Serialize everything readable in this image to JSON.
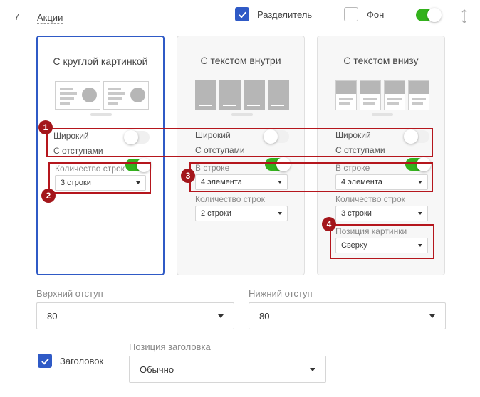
{
  "header": {
    "number": "7",
    "section_title": "Акции",
    "divider_label": "Разделитель",
    "background_label": "Фон"
  },
  "cards": [
    {
      "title": "С круглой картинкой",
      "wide_label": "Широкий",
      "padding_label": "С отступами",
      "rows_label": "Количество строк",
      "rows_value": "3 строки"
    },
    {
      "title": "С текстом внутри",
      "wide_label": "Широкий",
      "padding_label": "С отступами",
      "in_row_label": "В строке",
      "in_row_value": "4 элемента",
      "rows_label": "Количество строк",
      "rows_value": "2 строки"
    },
    {
      "title": "С текстом внизу",
      "wide_label": "Широкий",
      "padding_label": "С отступами",
      "in_row_label": "В строке",
      "in_row_value": "4 элемента",
      "rows_label": "Количество строк",
      "rows_value": "3 строки",
      "image_pos_label": "Позиция картинки",
      "image_pos_value": "Сверху"
    }
  ],
  "badges": [
    "1",
    "2",
    "3",
    "4"
  ],
  "bottom": {
    "top_padding_label": "Верхний отступ",
    "top_padding_value": "80",
    "bottom_padding_label": "Нижний отступ",
    "bottom_padding_value": "80",
    "heading_label": "Заголовок",
    "heading_pos_label": "Позиция заголовка",
    "heading_pos_value": "Обычно"
  },
  "colors": {
    "accent": "#2f5ac6",
    "toggle_on": "#33b21c",
    "annotation": "#b5161d"
  }
}
